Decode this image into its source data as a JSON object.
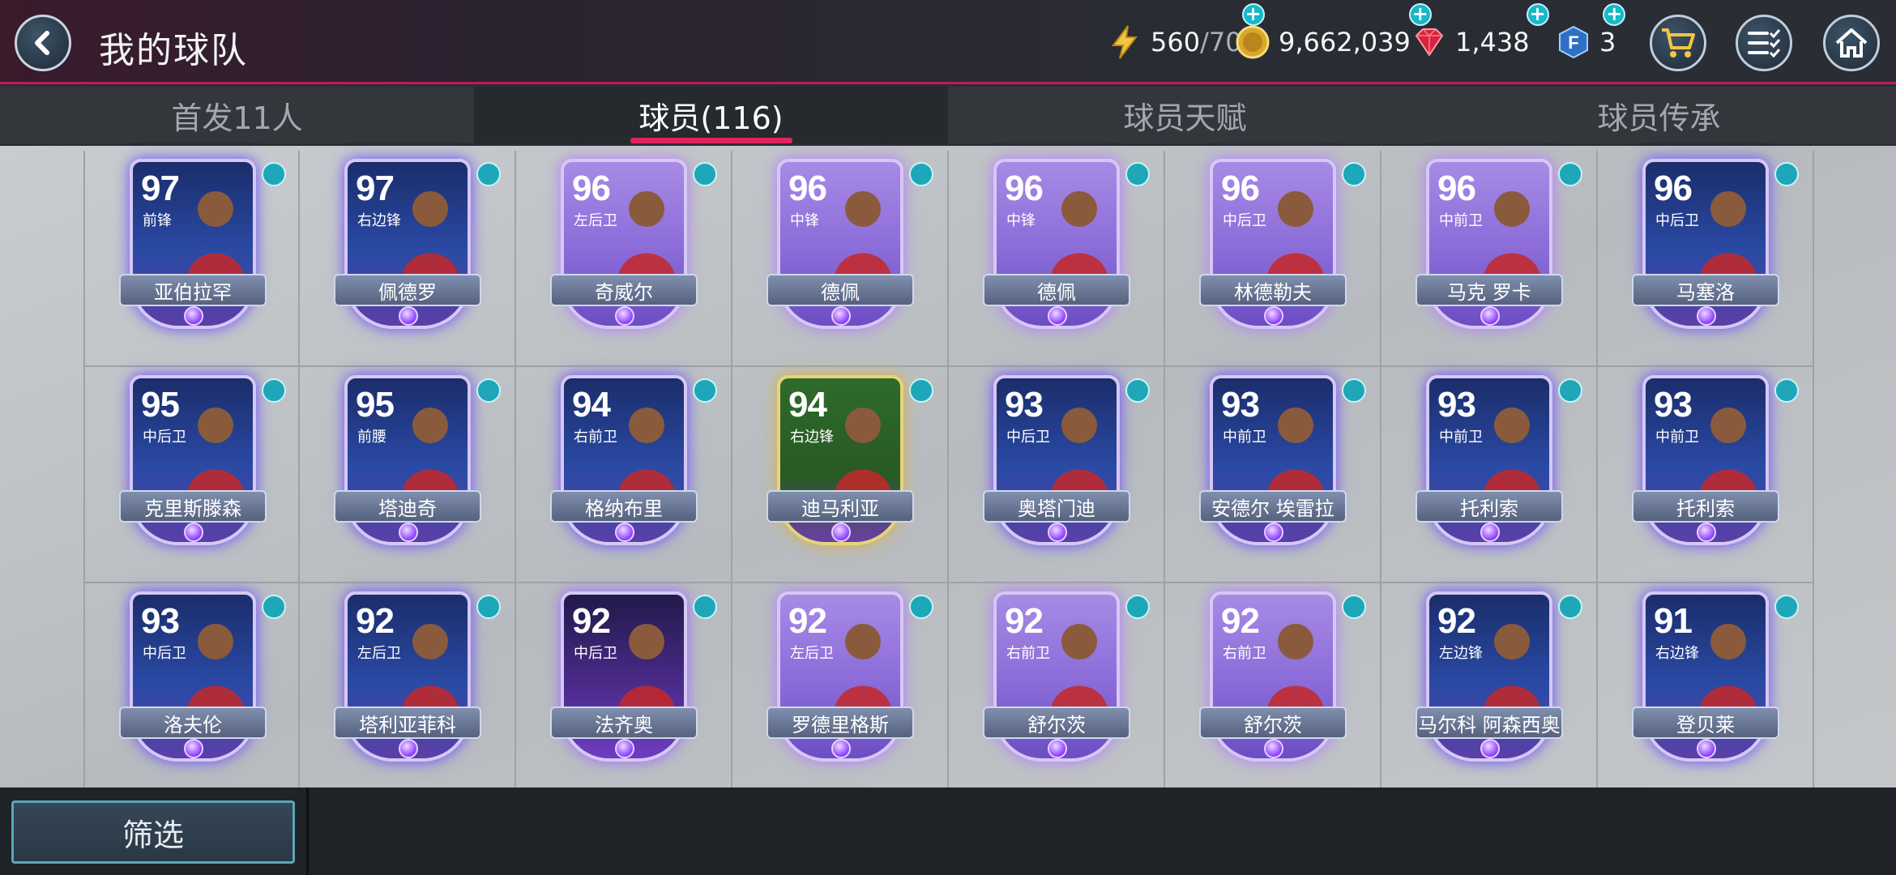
{
  "header": {
    "title": "我的球队",
    "energy": {
      "current": "560",
      "max": "/70"
    },
    "coins": "9,662,039",
    "gems": "1,438",
    "fifa_points": "3",
    "accent_color": "#e0245e"
  },
  "tabs": [
    {
      "label": "首发11人"
    },
    {
      "label": "球员(116)"
    },
    {
      "label": "球员天赋"
    },
    {
      "label": "球员传承"
    }
  ],
  "players": [
    {
      "rating": "97",
      "position": "前锋",
      "name": "亚伯拉罕",
      "card": "blue"
    },
    {
      "rating": "97",
      "position": "右边锋",
      "name": "佩德罗",
      "card": "blue"
    },
    {
      "rating": "96",
      "position": "左后卫",
      "name": "奇威尔",
      "card": "purple"
    },
    {
      "rating": "96",
      "position": "中锋",
      "name": "德佩",
      "card": "purple"
    },
    {
      "rating": "96",
      "position": "中锋",
      "name": "德佩",
      "card": "purple"
    },
    {
      "rating": "96",
      "position": "中后卫",
      "name": "林德勒夫",
      "card": "purple"
    },
    {
      "rating": "96",
      "position": "中前卫",
      "name": "马克 罗卡",
      "card": "purple"
    },
    {
      "rating": "96",
      "position": "中后卫",
      "name": "马塞洛",
      "card": "blue"
    },
    {
      "rating": "95",
      "position": "中后卫",
      "name": "克里斯滕森",
      "card": "blue"
    },
    {
      "rating": "95",
      "position": "前腰",
      "name": "塔迪奇",
      "card": "blue"
    },
    {
      "rating": "94",
      "position": "右前卫",
      "name": "格纳布里",
      "card": "blue"
    },
    {
      "rating": "94",
      "position": "右边锋",
      "name": "迪马利亚",
      "card": "green"
    },
    {
      "rating": "93",
      "position": "中后卫",
      "name": "奥塔门迪",
      "card": "blue"
    },
    {
      "rating": "93",
      "position": "中前卫",
      "name": "安德尔 埃雷拉",
      "card": "blue"
    },
    {
      "rating": "93",
      "position": "中前卫",
      "name": "托利索",
      "card": "blue"
    },
    {
      "rating": "93",
      "position": "中前卫",
      "name": "托利索",
      "card": "blue"
    },
    {
      "rating": "93",
      "position": "中后卫",
      "name": "洛夫伦",
      "card": "blue"
    },
    {
      "rating": "92",
      "position": "左后卫",
      "name": "塔利亚菲科",
      "card": "blue"
    },
    {
      "rating": "92",
      "position": "中后卫",
      "name": "法齐奥",
      "card": "dark"
    },
    {
      "rating": "92",
      "position": "左后卫",
      "name": "罗德里格斯",
      "card": "purple"
    },
    {
      "rating": "92",
      "position": "右前卫",
      "name": "舒尔茨",
      "card": "purple"
    },
    {
      "rating": "92",
      "position": "右前卫",
      "name": "舒尔茨",
      "card": "purple"
    },
    {
      "rating": "92",
      "position": "左边锋",
      "name": "马尔科 阿森西奥",
      "card": "blue"
    },
    {
      "rating": "91",
      "position": "右边锋",
      "name": "登贝莱",
      "card": "blue"
    }
  ],
  "bottom": {
    "filter_label": "筛选"
  }
}
